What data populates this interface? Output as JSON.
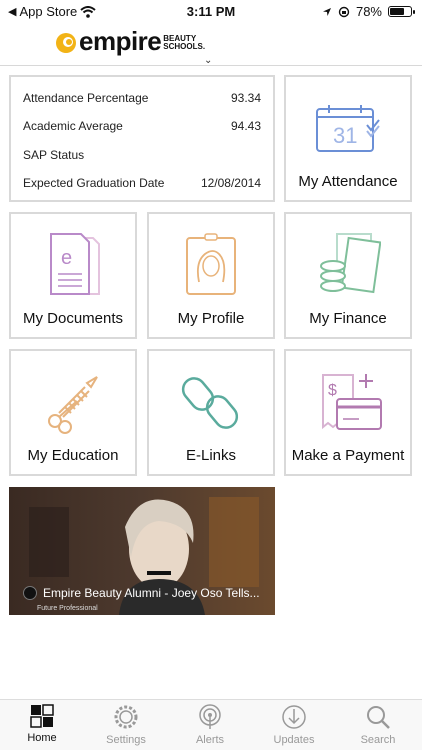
{
  "status_bar": {
    "back_app": "App Store",
    "time": "3:11 PM",
    "battery": "78%",
    "battery_level": 0.78
  },
  "header": {
    "logo_word": "empire",
    "logo_sub_line1": "BEAUTY",
    "logo_sub_line2": "SCHOOLS."
  },
  "info": {
    "rows": [
      {
        "label": "Attendance Percentage",
        "value": "93.34"
      },
      {
        "label": "Academic Average",
        "value": "94.43"
      },
      {
        "label": "SAP Status",
        "value": ""
      },
      {
        "label": "Expected Graduation Date",
        "value": "12/08/2014"
      }
    ]
  },
  "tiles": {
    "attendance": {
      "label": "My Attendance",
      "calendar_day": "31"
    },
    "documents": {
      "label": "My Documents",
      "doc_letter": "e"
    },
    "profile": {
      "label": "My Profile"
    },
    "finance": {
      "label": "My Finance"
    },
    "education": {
      "label": "My Education"
    },
    "elinks": {
      "label": "E-Links"
    },
    "payment": {
      "label": "Make a Payment",
      "receipt_symbol": "$"
    }
  },
  "video": {
    "title": "Empire Beauty Alumni - Joey Oso Tells...",
    "subtitle": "Future Professional"
  },
  "tabbar": {
    "items": [
      {
        "label": "Home",
        "icon": "grid-icon",
        "active": true
      },
      {
        "label": "Settings",
        "icon": "gear-icon",
        "active": false
      },
      {
        "label": "Alerts",
        "icon": "broadcast-icon",
        "active": false
      },
      {
        "label": "Updates",
        "icon": "download-icon",
        "active": false
      },
      {
        "label": "Search",
        "icon": "search-icon",
        "active": false
      }
    ]
  },
  "colors": {
    "tile_border": "#d9d9d9",
    "attendance_blue": "#6b8fd6",
    "documents_purple": "#b98ac9",
    "profile_peach": "#e8b37a",
    "finance_green": "#7fbf9a",
    "education_peach": "#e6b37e",
    "elinks_teal": "#5aab9d",
    "payment_purple": "#b27ab0",
    "logo_yellow": "#f2b316"
  }
}
